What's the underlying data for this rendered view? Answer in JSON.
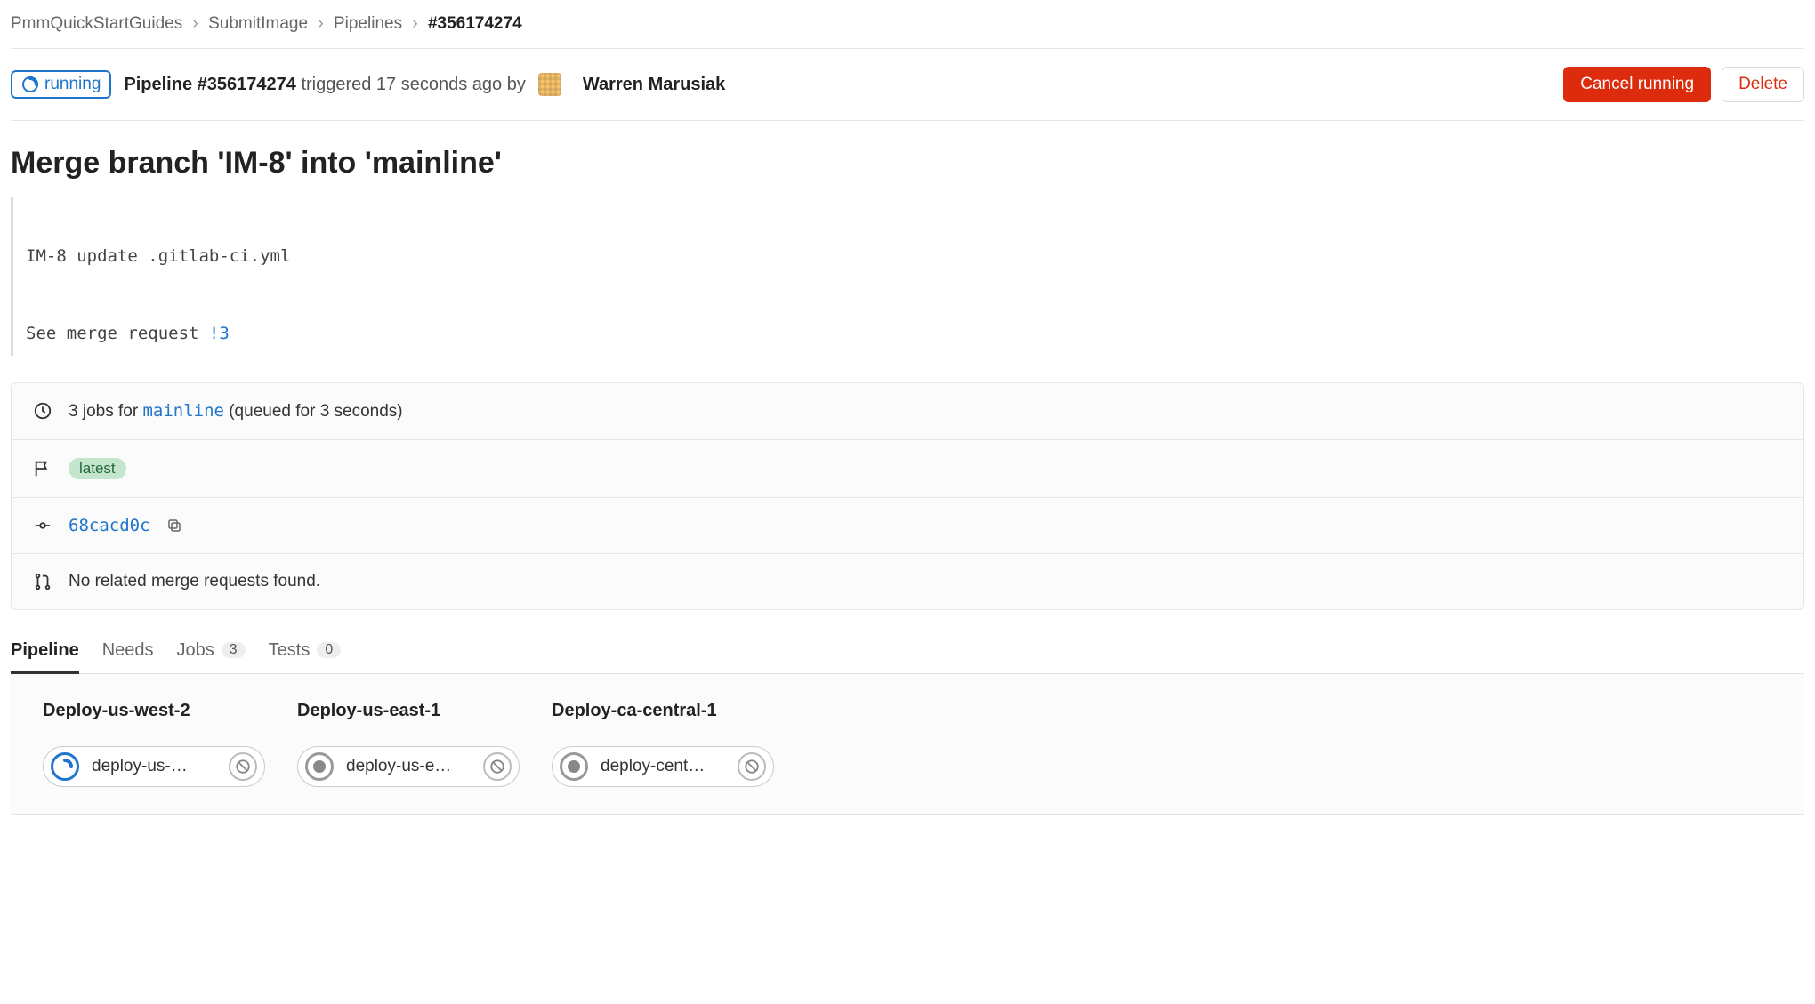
{
  "breadcrumb": {
    "items": [
      "PmmQuickStartGuides",
      "SubmitImage",
      "Pipelines"
    ],
    "current": "#356174274"
  },
  "header": {
    "status": "running",
    "pipeline_title_bold": "Pipeline #356174274",
    "triggered_text": "triggered 17 seconds ago by",
    "user_name": "Warren Marusiak",
    "cancel_label": "Cancel running",
    "delete_label": "Delete"
  },
  "commit": {
    "title": "Merge branch 'IM-8' into 'mainline'",
    "desc_line1": "IM-8 update .gitlab-ci.yml",
    "desc_line2_pre": "See merge request ",
    "desc_mr": "!3"
  },
  "info": {
    "jobs_count_prefix": "3 jobs for",
    "branch": "mainline",
    "queued_text": "(queued for 3 seconds)",
    "tag": "latest",
    "commit_sha": "68cacd0c",
    "no_mr_text": "No related merge requests found."
  },
  "tabs": {
    "pipeline": "Pipeline",
    "needs": "Needs",
    "jobs": "Jobs",
    "jobs_count": "3",
    "tests": "Tests",
    "tests_count": "0"
  },
  "stages": [
    {
      "title": "Deploy-us-west-2",
      "job": "deploy-us-…",
      "status": "running"
    },
    {
      "title": "Deploy-us-east-1",
      "job": "deploy-us-e…",
      "status": "manual"
    },
    {
      "title": "Deploy-ca-central-1",
      "job": "deploy-cent…",
      "status": "manual"
    }
  ]
}
